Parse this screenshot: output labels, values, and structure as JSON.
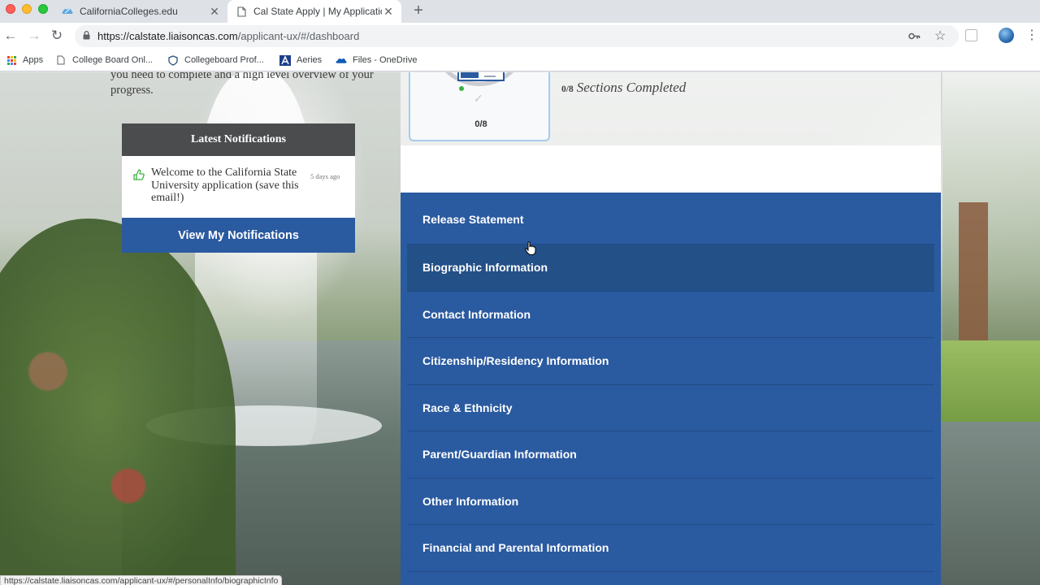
{
  "browser": {
    "tabs": [
      {
        "title": "CaliforniaColleges.edu",
        "icon": "cloud-favicon-icon",
        "active": false
      },
      {
        "title": "Cal State Apply | My Applicatio",
        "icon": "page-favicon-icon",
        "active": true
      }
    ],
    "url_host": "https://calstate.liaisoncas.com",
    "url_path": "/applicant-ux/#/dashboard",
    "bookmarks": [
      {
        "label": "Apps",
        "icon": "apps-grid-icon"
      },
      {
        "label": "College Board Onl...",
        "icon": "page-icon"
      },
      {
        "label": "Collegeboard Prof...",
        "icon": "shield-icon"
      },
      {
        "label": "Aeries",
        "icon": "aeries-logo-icon"
      },
      {
        "label": "Files - OneDrive",
        "icon": "onedrive-cloud-icon"
      }
    ],
    "status_url": "https://calstate.liaisoncas.com/applicant-ux/#/personalInfo/biographicInfo"
  },
  "intro": {
    "text": "you need to complete and a high level overview of your progress."
  },
  "notifications": {
    "header": "Latest Notifications",
    "items": [
      {
        "text": "Welcome to the California State University application (save this email!)",
        "time": "5 days ago",
        "icon": "thumbs-up-icon"
      }
    ],
    "button_label": "View My Notifications"
  },
  "progress": {
    "count_label": "0/8",
    "fraction_label": "0/8",
    "sections_label": "Sections Completed",
    "completed": 0,
    "total": 8
  },
  "sections": [
    {
      "label": "Release Statement"
    },
    {
      "label": "Biographic Information"
    },
    {
      "label": "Contact Information"
    },
    {
      "label": "Citizenship/Residency Information"
    },
    {
      "label": "Race & Ethnicity"
    },
    {
      "label": "Parent/Guardian Information"
    },
    {
      "label": "Other Information"
    },
    {
      "label": "Financial and Parental Information"
    }
  ],
  "colors": {
    "primary_blue": "#2a5aa0",
    "hover_blue": "#245088",
    "notification_header": "#4a4c4e",
    "progress_green": "#3cb043"
  }
}
